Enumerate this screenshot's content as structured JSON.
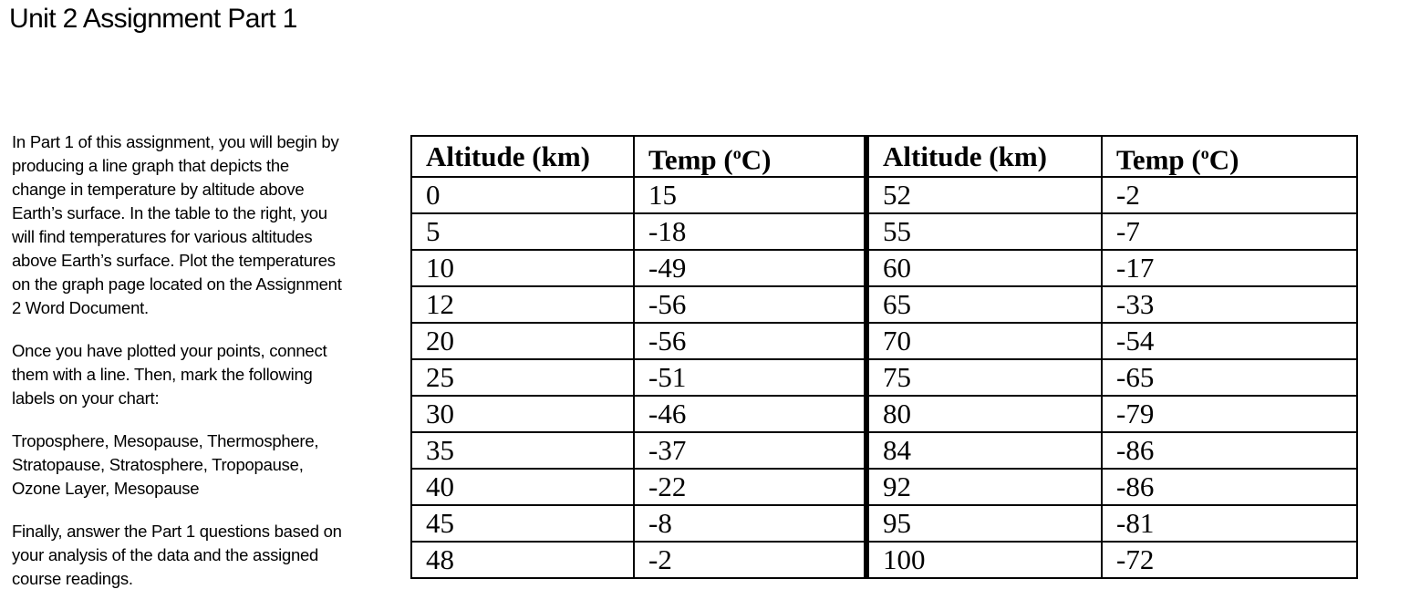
{
  "title": "Unit 2 Assignment Part 1",
  "instructions": [
    [
      "In Part 1 of this assignment, you will begin by",
      "producing a line graph that depicts the",
      "change in temperature by altitude above",
      "Earth’s surface. In the table to the right, you",
      "will find temperatures for various altitudes",
      "above Earth’s surface. Plot the temperatures",
      "on the graph page located on the Assignment",
      "2 Word Document."
    ],
    [
      "Once you have plotted your points, connect",
      "them with a line. Then, mark the following",
      "labels on your chart:"
    ],
    [
      "Troposphere, Mesopause, Thermosphere,",
      "Stratopause, Stratosphere, Tropopause,",
      "Ozone Layer, Mesopause"
    ],
    [
      "Finally, answer the Part 1 questions based on",
      "your analysis of the data and the assigned",
      "course readings."
    ]
  ],
  "table": {
    "headers": {
      "altitude": "Altitude (km)",
      "temp_prefix": "Temp (",
      "temp_sup": "o",
      "temp_suffix": "C)"
    },
    "rows": [
      [
        "0",
        "15",
        "52",
        "-2"
      ],
      [
        "5",
        "-18",
        "55",
        "-7"
      ],
      [
        "10",
        "-49",
        "60",
        "-17"
      ],
      [
        "12",
        "-56",
        "65",
        "-33"
      ],
      [
        "20",
        "-56",
        "70",
        "-54"
      ],
      [
        "25",
        "-51",
        "75",
        "-65"
      ],
      [
        "30",
        "-46",
        "80",
        "-79"
      ],
      [
        "35",
        "-37",
        "84",
        "-86"
      ],
      [
        "40",
        "-22",
        "92",
        "-86"
      ],
      [
        "45",
        "-8",
        "95",
        "-81"
      ],
      [
        "48",
        "-2",
        "100",
        "-72"
      ]
    ]
  }
}
